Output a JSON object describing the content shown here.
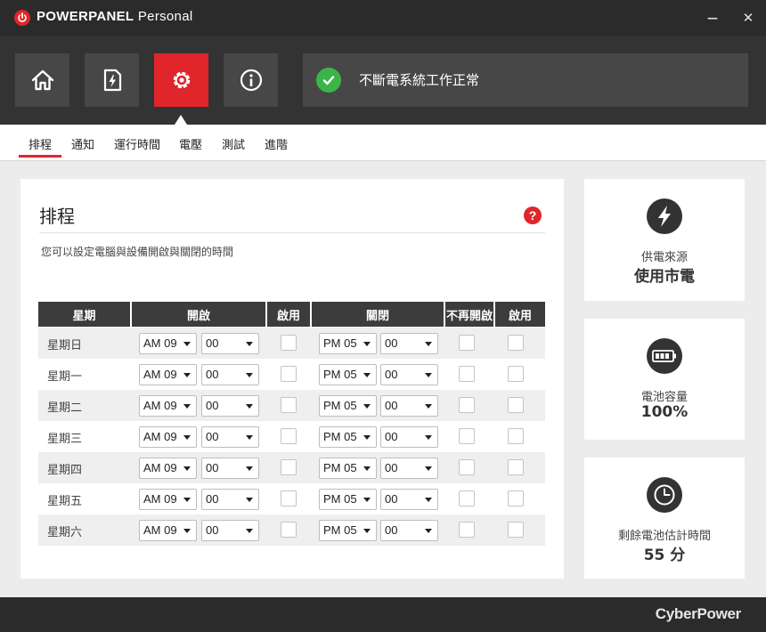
{
  "app": {
    "title_bold": "POWERPANEL",
    "title_light": "Personal",
    "minimize_glyph": "—",
    "close_glyph": "✕"
  },
  "main_tabs": [
    {
      "icon": "home-icon"
    },
    {
      "icon": "power-status-icon"
    },
    {
      "icon": "gear-icon",
      "active": true
    },
    {
      "icon": "info-icon"
    }
  ],
  "status": {
    "text": "不斷電系統工作正常",
    "icon": "check-icon",
    "color": "#3bb54a"
  },
  "sub_tabs": [
    "排程",
    "通知",
    "運行時間",
    "電壓",
    "測試",
    "進階"
  ],
  "schedule": {
    "title": "排程",
    "help_glyph": "?",
    "description": "您可以設定電腦與設備開啟與關閉的時間",
    "headers": {
      "day": "星期",
      "on": "開啟",
      "on_enable": "啟用",
      "off": "關閉",
      "no_restart": "不再開啟",
      "off_enable": "啟用"
    },
    "rows": [
      {
        "day": "星期日",
        "on_hour": "AM 09",
        "on_min": "00",
        "off_hour": "PM 05",
        "off_min": "00"
      },
      {
        "day": "星期一",
        "on_hour": "AM 09",
        "on_min": "00",
        "off_hour": "PM 05",
        "off_min": "00"
      },
      {
        "day": "星期二",
        "on_hour": "AM 09",
        "on_min": "00",
        "off_hour": "PM 05",
        "off_min": "00"
      },
      {
        "day": "星期三",
        "on_hour": "AM 09",
        "on_min": "00",
        "off_hour": "PM 05",
        "off_min": "00"
      },
      {
        "day": "星期四",
        "on_hour": "AM 09",
        "on_min": "00",
        "off_hour": "PM 05",
        "off_min": "00"
      },
      {
        "day": "星期五",
        "on_hour": "AM 09",
        "on_min": "00",
        "off_hour": "PM 05",
        "off_min": "00"
      },
      {
        "day": "星期六",
        "on_hour": "AM 09",
        "on_min": "00",
        "off_hour": "PM 05",
        "off_min": "00"
      }
    ]
  },
  "side": {
    "power_source": {
      "label": "供電來源",
      "value": "使用市電",
      "icon": "lightning-icon"
    },
    "battery_capacity": {
      "label": "電池容量",
      "value": "100%",
      "icon": "battery-icon"
    },
    "runtime": {
      "label": "剩餘電池估計時間",
      "value": "55 分",
      "icon": "clock-icon"
    }
  },
  "footer": {
    "brand": "CyberPower"
  },
  "colors": {
    "accent": "#e0252b",
    "dark_bar": "#333333",
    "title_bar": "#2b2b2b",
    "ok_green": "#3bb54a"
  }
}
